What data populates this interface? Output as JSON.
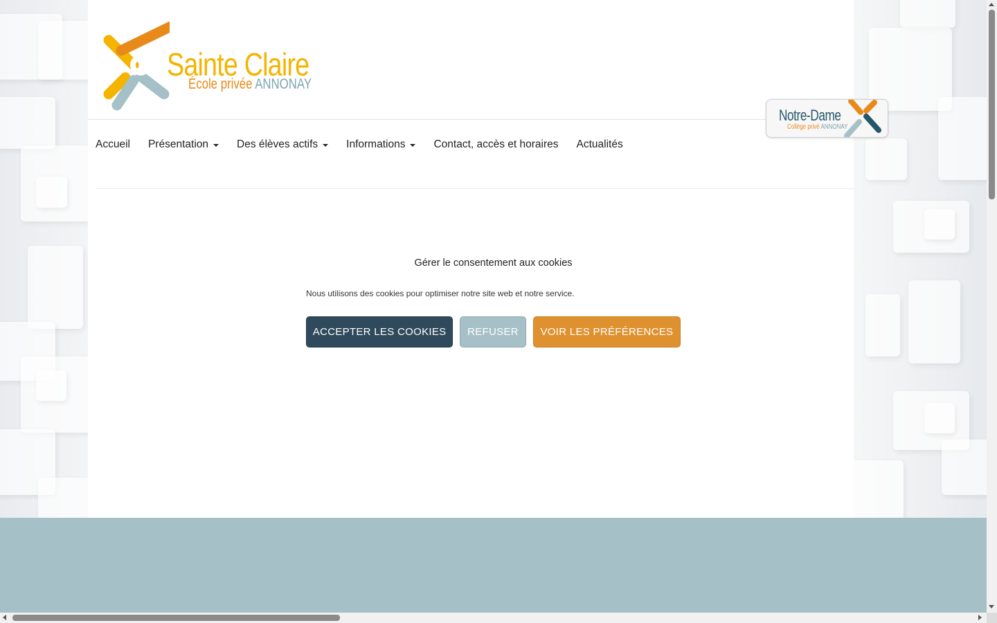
{
  "logo": {
    "name": "Sainte Claire",
    "subtitle_a": "École privée",
    "subtitle_b": "ANNONAY"
  },
  "nav": {
    "items": [
      {
        "label": "Accueil",
        "dropdown": false
      },
      {
        "label": "Présentation",
        "dropdown": true
      },
      {
        "label": "Des élèves actifs",
        "dropdown": true
      },
      {
        "label": "Informations",
        "dropdown": true
      },
      {
        "label": "Contact, accès et horaires",
        "dropdown": false
      },
      {
        "label": "Actualités",
        "dropdown": false
      }
    ]
  },
  "partner": {
    "name": "Notre-Dame",
    "subtitle_a": "Collège privé",
    "subtitle_b": "ANNONAY"
  },
  "cookie": {
    "title": "Gérer le consentement aux cookies",
    "text": "Nous utilisons des cookies pour optimiser notre site web et notre service.",
    "accept_label": "ACCEPTER LES COOKIES",
    "refuse_label": "REFUSER",
    "prefs_label": "VOIR LES PRÉFÉRENCES"
  },
  "colors": {
    "logo_yellow": "#f4b400",
    "logo_orange": "#e88a1a",
    "logo_grey": "#7fa3ad",
    "accept_button": "#2f4a5c",
    "refuse_button": "#a5c1c7",
    "prefs_button": "#e0912f",
    "footer_band": "#a5c1c7"
  }
}
